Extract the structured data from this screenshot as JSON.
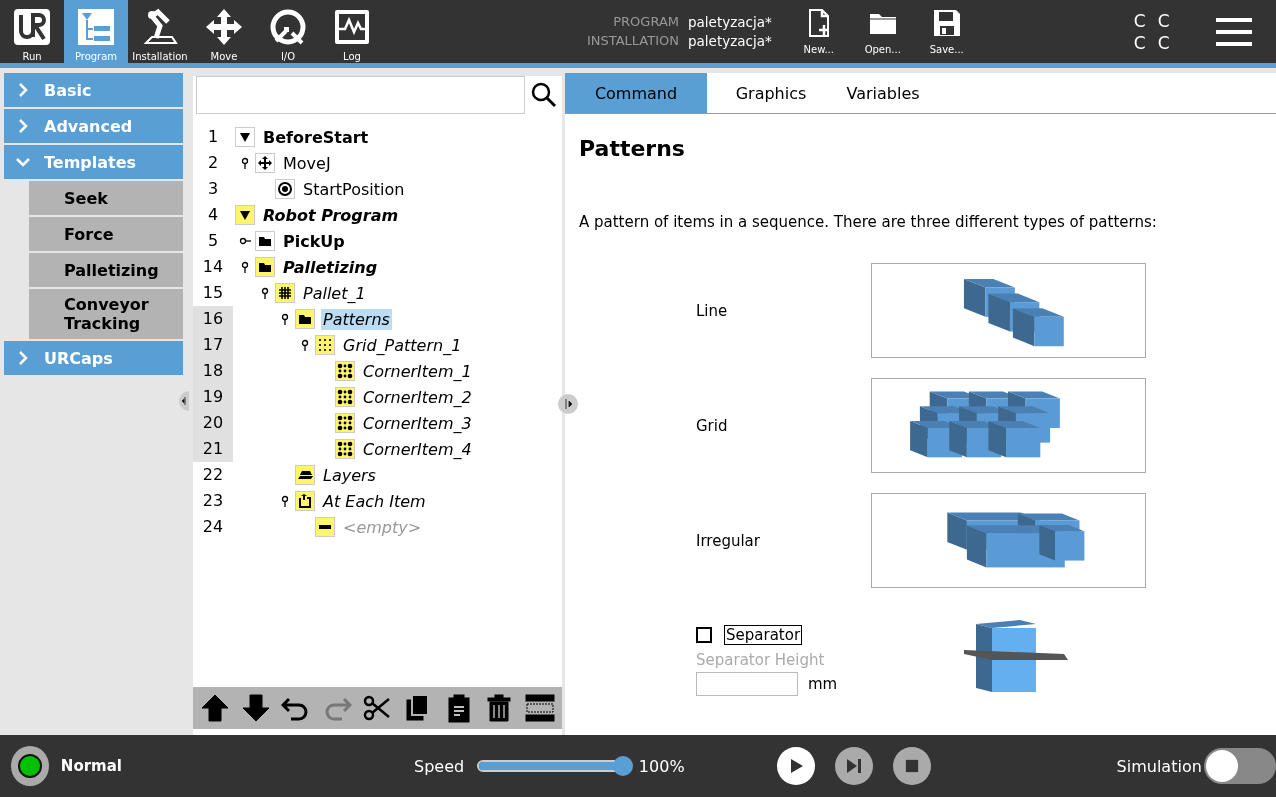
{
  "nav": [
    {
      "label": "Run",
      "kind": "logo",
      "selected": false
    },
    {
      "label": "Program",
      "kind": "program",
      "selected": true
    },
    {
      "label": "Installation",
      "kind": "robot",
      "selected": false
    },
    {
      "label": "Move",
      "kind": "move",
      "selected": false
    },
    {
      "label": "I/O",
      "kind": "io",
      "selected": false
    },
    {
      "label": "Log",
      "kind": "log",
      "selected": false
    }
  ],
  "files": [
    {
      "key": "PROGRAM",
      "value": "paletyzacja*"
    },
    {
      "key": "INSTALLATION",
      "value": "paletyzacja*"
    }
  ],
  "file_buttons": [
    {
      "label": "New...",
      "kind": "new"
    },
    {
      "label": "Open...",
      "kind": "open"
    },
    {
      "label": "Save...",
      "kind": "save"
    }
  ],
  "status_letters": [
    "C",
    "C",
    "C",
    "C"
  ],
  "sidebar": [
    {
      "label": "Basic",
      "expanded": false
    },
    {
      "label": "Advanced",
      "expanded": false
    },
    {
      "label": "Templates",
      "expanded": true,
      "children": [
        "Seek",
        "Force",
        "Palletizing",
        "Conveyor Tracking"
      ]
    },
    {
      "label": "URCaps",
      "expanded": false
    }
  ],
  "tree": [
    {
      "line": "1",
      "label": "BeforeStart",
      "kind": "triangle",
      "bold": true,
      "italic": false,
      "highlighted": false,
      "selected": false,
      "expanded": true,
      "children": [
        {
          "line": "2",
          "label": "MoveJ",
          "kind": "move",
          "bold": false,
          "italic": false,
          "highlighted": false,
          "selected": false,
          "expanded": true,
          "children": [
            {
              "line": "3",
              "label": "StartPosition",
              "kind": "waypoint",
              "bold": false,
              "italic": false,
              "highlighted": false,
              "selected": false
            }
          ]
        }
      ]
    },
    {
      "line": "4",
      "label": "Robot Program",
      "kind": "triangle",
      "bold": true,
      "italic": true,
      "highlighted": true,
      "selected": false,
      "expanded": true,
      "children": [
        {
          "line": "5",
          "label": "PickUp",
          "kind": "folder",
          "bold": true,
          "italic": false,
          "highlighted": false,
          "selected": false,
          "expanded": false
        },
        {
          "line": "14",
          "label": "Palletizing",
          "kind": "folder",
          "bold": true,
          "italic": true,
          "highlighted": true,
          "selected": false,
          "expanded": true,
          "children": [
            {
              "line": "15",
              "label": "Pallet_1",
              "kind": "pallet",
              "bold": false,
              "italic": true,
              "highlighted": true,
              "selected": false,
              "expanded": true,
              "children": [
                {
                  "line": "16",
                  "label": "Patterns",
                  "kind": "folder",
                  "bold": false,
                  "italic": true,
                  "highlighted": true,
                  "selected": true,
                  "expanded": true,
                  "children": [
                    {
                      "line": "17",
                      "label": "Grid_Pattern_1",
                      "kind": "grid",
                      "bold": false,
                      "italic": true,
                      "highlighted": true,
                      "selected": false,
                      "expanded": true,
                      "children": [
                        {
                          "line": "18",
                          "label": "CornerItem_1",
                          "kind": "corner",
                          "bold": false,
                          "italic": true,
                          "highlighted": true,
                          "selected": false
                        },
                        {
                          "line": "19",
                          "label": "CornerItem_2",
                          "kind": "corner",
                          "bold": false,
                          "italic": true,
                          "highlighted": true,
                          "selected": false
                        },
                        {
                          "line": "20",
                          "label": "CornerItem_3",
                          "kind": "corner",
                          "bold": false,
                          "italic": true,
                          "highlighted": true,
                          "selected": false
                        },
                        {
                          "line": "21",
                          "label": "CornerItem_4",
                          "kind": "corner",
                          "bold": false,
                          "italic": true,
                          "highlighted": true,
                          "selected": false
                        }
                      ]
                    }
                  ]
                },
                {
                  "line": "22",
                  "label": "Layers",
                  "kind": "layers",
                  "bold": false,
                  "italic": true,
                  "highlighted": true,
                  "selected": false
                },
                {
                  "line": "23",
                  "label": "At Each Item",
                  "kind": "loop",
                  "bold": false,
                  "italic": true,
                  "highlighted": true,
                  "selected": false,
                  "expanded": true,
                  "children": [
                    {
                      "line": "24",
                      "label": "<empty>",
                      "kind": "empty",
                      "bold": false,
                      "italic": true,
                      "highlighted": true,
                      "selected": false,
                      "dimmed": true
                    }
                  ]
                }
              ]
            }
          ]
        }
      ]
    }
  ],
  "tree_tools": [
    {
      "kind": "up",
      "disabled": false
    },
    {
      "kind": "down",
      "disabled": false
    },
    {
      "kind": "undo",
      "disabled": false
    },
    {
      "kind": "redo",
      "disabled": true
    },
    {
      "kind": "cut",
      "disabled": false
    },
    {
      "kind": "copy",
      "disabled": false
    },
    {
      "kind": "paste",
      "disabled": false
    },
    {
      "kind": "delete",
      "disabled": false
    },
    {
      "kind": "suppress",
      "disabled": false
    }
  ],
  "tabs": [
    {
      "label": "Command",
      "selected": true
    },
    {
      "label": "Graphics",
      "selected": false
    },
    {
      "label": "Variables",
      "selected": false
    }
  ],
  "command": {
    "title": "Patterns",
    "description": "A pattern of items in a sequence. There are three different types of patterns:",
    "patterns": [
      {
        "label": "Line",
        "kind": "line"
      },
      {
        "label": "Grid",
        "kind": "grid"
      },
      {
        "label": "Irregular",
        "kind": "irregular"
      }
    ],
    "separator": {
      "label": "Separator",
      "checked": false,
      "height_label": "Separator Height",
      "unit": "mm"
    }
  },
  "footer": {
    "status": "Normal",
    "speed_label": "Speed",
    "speed": {
      "level": 1.0
    },
    "speed_reading": "100%",
    "simulation_label": "Simulation",
    "simulation_on": false
  }
}
